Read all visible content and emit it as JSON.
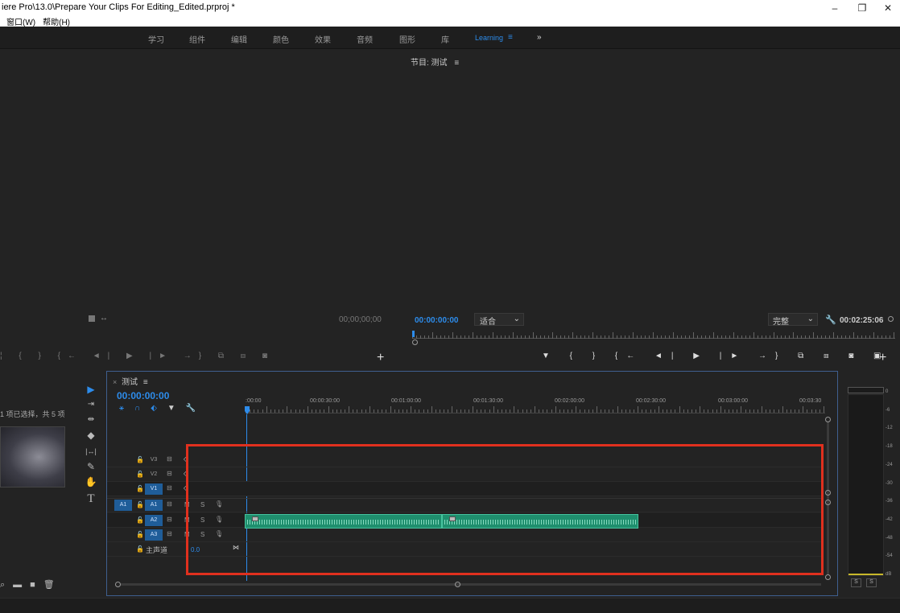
{
  "titlebar": {
    "title": "iere Pro\\13.0\\Prepare Your Clips For Editing_Edited.prproj *",
    "menu": [
      "窗口(W)",
      "帮助(H)"
    ],
    "min": "–",
    "restore": "❐",
    "close": "✕"
  },
  "workspaces": [
    "学习",
    "组件",
    "编辑",
    "颜色",
    "效果",
    "音频",
    "图形",
    "库",
    "Learning",
    "»"
  ],
  "workspace_active": "Learning",
  "workspace_menu_icon": "≡",
  "source": {
    "timecode": "00;00;00;00"
  },
  "program": {
    "tab_label": "节目: 测试",
    "menu_icon": "≡",
    "timecode": "00:00:00:00",
    "fit": "适合",
    "quality": "完整",
    "duration": "00:02:25:06"
  },
  "project": {
    "selection_text": "1 项已选择，共 5 项"
  },
  "timeline": {
    "tab_label": "测试",
    "menu_icon": "≡",
    "close_icon": "×",
    "timecode": "00:00:00:00",
    "ruler": [
      ":00:00",
      "00:00:30:00",
      "00:01:00:00",
      "00:01:30:00",
      "00:02:00:00",
      "00:02:30:00",
      "00:03:00:00",
      "00:03:30"
    ],
    "tracks": [
      {
        "name": "V3",
        "source": "",
        "mute": "",
        "solo": ""
      },
      {
        "name": "V2",
        "source": "",
        "mute": "",
        "solo": ""
      },
      {
        "name": "V1",
        "source": "",
        "mute": "",
        "solo": ""
      },
      {
        "name": "A1",
        "source": "A1",
        "mute": "M",
        "solo": "S"
      },
      {
        "name": "A2",
        "source": "",
        "mute": "M",
        "solo": "S"
      },
      {
        "name": "A3",
        "source": "",
        "mute": "M",
        "solo": "S"
      }
    ],
    "master": {
      "label": "主声道",
      "value": "0.0"
    }
  },
  "meters": {
    "labels": [
      "0",
      "-6",
      "-12",
      "-18",
      "-24",
      "-30",
      "-36",
      "-42",
      "-48",
      "-54",
      "dB"
    ],
    "solo_left": "S",
    "solo_right": "S"
  },
  "colors": {
    "accent": "#2d8ceb",
    "clip": "#1f8f6e",
    "highlight_box": "#e0301e",
    "timeline_border": "#3f5f8f"
  }
}
